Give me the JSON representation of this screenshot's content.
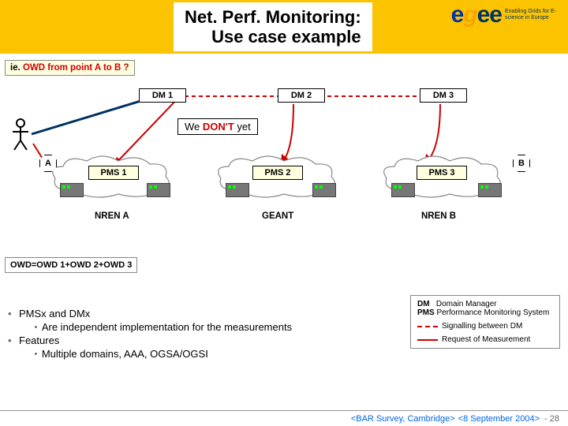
{
  "title_l1": "Net. Perf. Monitoring:",
  "title_l2": "Use case example",
  "logo": {
    "text": "eGee",
    "tag": "Enabling Grids for E-science in Europe"
  },
  "callout": {
    "pre": "ie. ",
    "red": "OWD from point A to B ?"
  },
  "dm": {
    "dm1": "DM 1",
    "dm2": "DM 2",
    "dm3": "DM 3"
  },
  "overlay": {
    "pre": "We ",
    "dont": "DON'T",
    "post": " yet"
  },
  "pms": {
    "pms1": "PMS 1",
    "pms2": "PMS 2",
    "pms3": "PMS 3"
  },
  "ab": {
    "a": "A",
    "b": "B"
  },
  "nren": {
    "a": "NREN A",
    "g": "GEANT",
    "b": "NREN B"
  },
  "owd": "OWD=OWD 1+OWD 2+OWD 3",
  "bullets": {
    "b1": "PMSx and DMx",
    "b1s": "Are independent implementation for the measurements",
    "b2": "Features",
    "b2s": "Multiple domains, AAA, OGSA/OGSI"
  },
  "legend": {
    "dm_line": "DM   Domain Manager",
    "pms_line": "PMS Performance Monitoring System",
    "sig": "Signalling between DM",
    "req": "Request of Measurement"
  },
  "footer": {
    "a": "<BAR Survey, Cambridge>",
    "b": "<8 September 2004>",
    "page": "- 28"
  }
}
